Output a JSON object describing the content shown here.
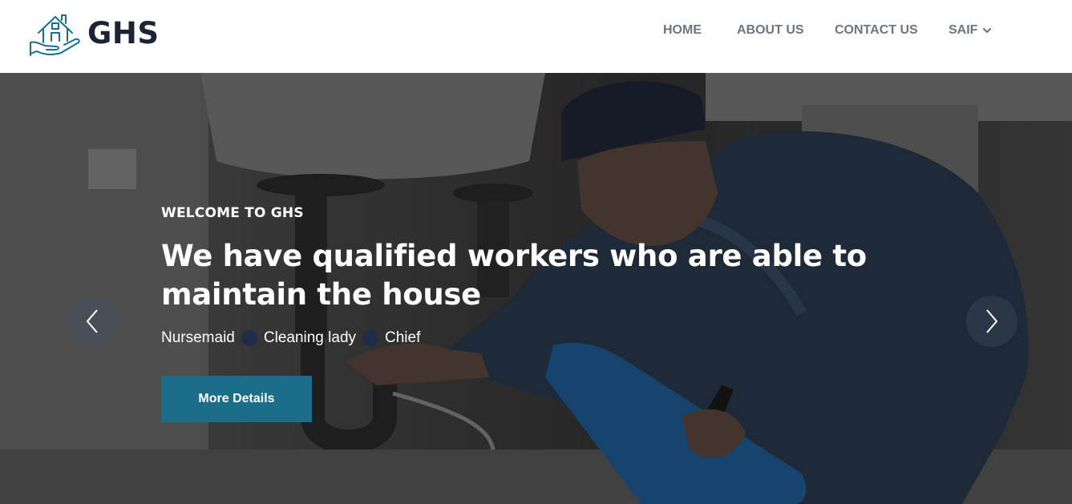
{
  "header": {
    "logo_text": "GHS",
    "logo_icon": "house-in-hand-icon",
    "nav": [
      {
        "label": "HOME"
      },
      {
        "label": "ABOUT US"
      },
      {
        "label": "CONTACT US"
      },
      {
        "label": "SAIF"
      }
    ]
  },
  "hero": {
    "welcome": "WELCOME TO GHS",
    "headline": "We have qualified workers who are able to maintain the house",
    "roles": [
      "Nursemaid",
      "Cleaning lady",
      "Chief"
    ],
    "button_label": "More Details",
    "prev_icon": "chevron-left-icon",
    "next_icon": "chevron-right-icon"
  },
  "colors": {
    "accent": "#1b6d8a",
    "logo_text": "#1b2434",
    "nav_text": "#6d7580",
    "dot": "#1e2d4a"
  }
}
